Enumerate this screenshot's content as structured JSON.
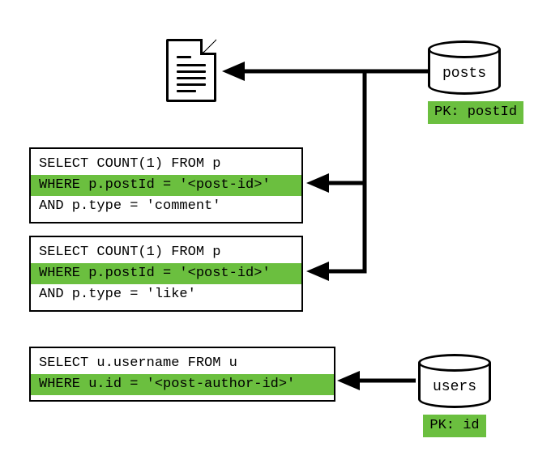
{
  "doc_icon": {
    "name": "document-icon"
  },
  "posts_db": {
    "label": "posts",
    "pk": "PK: postId"
  },
  "users_db": {
    "label": "users",
    "pk": "PK: id"
  },
  "query1": {
    "line1": "SELECT COUNT(1) FROM p",
    "line2": "WHERE p.postId = '<post-id>'",
    "line3": "AND p.type = 'comment'"
  },
  "query2": {
    "line1": "SELECT COUNT(1) FROM p",
    "line2": "WHERE p.postId = '<post-id>'",
    "line3": "AND p.type = 'like'"
  },
  "query3": {
    "line1": "SELECT u.username FROM u",
    "line2": "WHERE u.id = '<post-author-id>'"
  }
}
